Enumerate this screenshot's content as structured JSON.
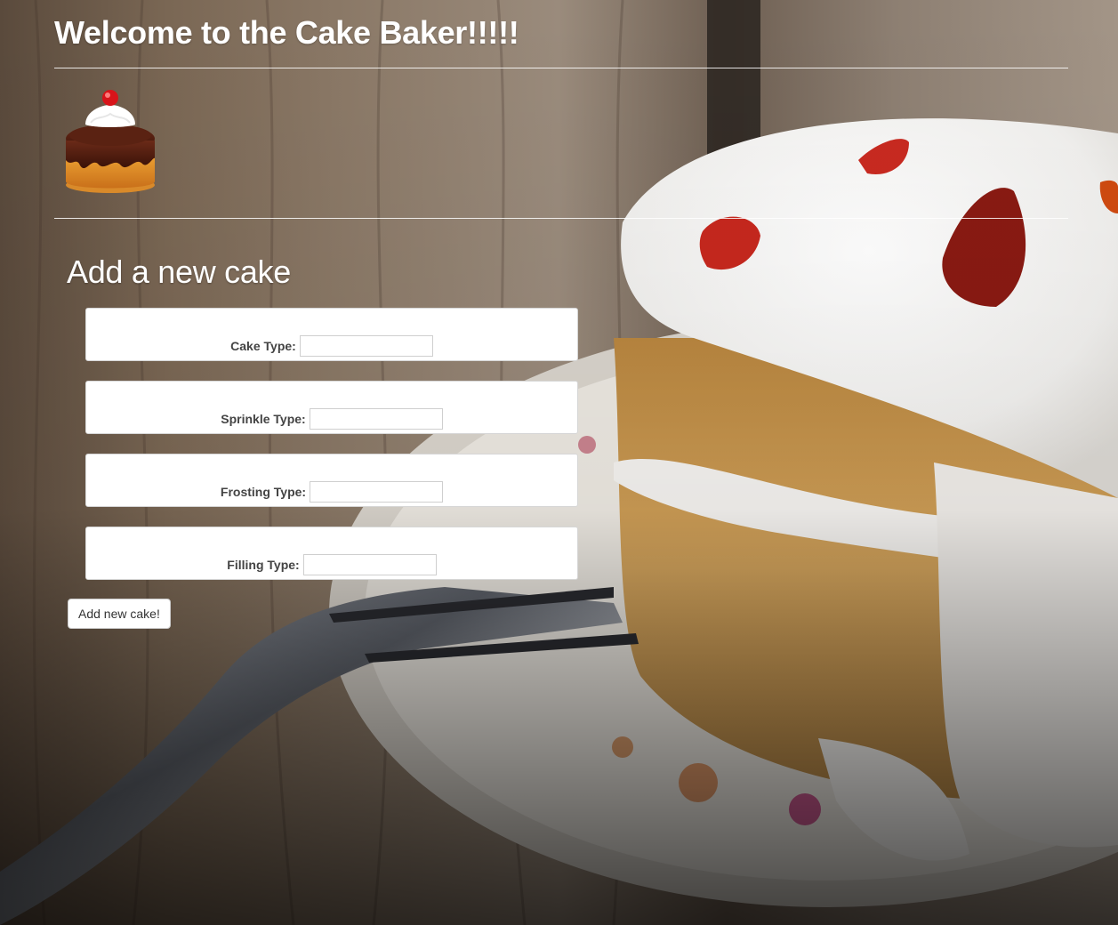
{
  "header": {
    "title": "Welcome to the Cake Baker!!!!!"
  },
  "logo": {
    "icon": "cake-icon"
  },
  "form": {
    "heading": "Add a new cake",
    "fields": [
      {
        "label": "Cake Type:",
        "value": ""
      },
      {
        "label": "Sprinkle Type:",
        "value": ""
      },
      {
        "label": "Frosting Type:",
        "value": ""
      },
      {
        "label": "Filling Type:",
        "value": ""
      }
    ],
    "submit_label": "Add new cake!"
  },
  "colors": {
    "text_light": "#ffffff",
    "label_text": "#444444",
    "card_bg": "#ffffff"
  }
}
